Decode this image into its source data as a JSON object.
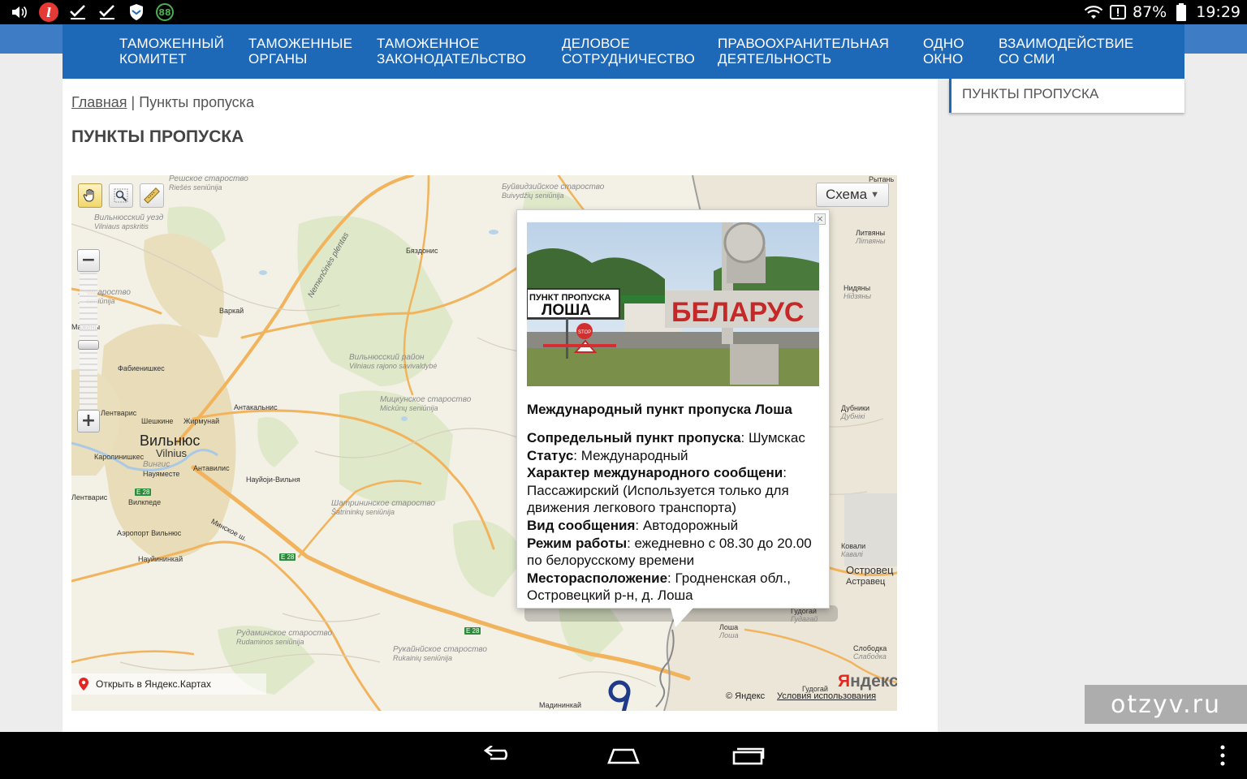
{
  "statusbar": {
    "battery_percent": "87%",
    "time": "19:29",
    "badge_88": "88",
    "app_l": "l"
  },
  "nav": {
    "items": [
      {
        "line1": "Таможенный",
        "line2": "комитет"
      },
      {
        "line1": "Таможенные",
        "line2": "органы"
      },
      {
        "line1": "Таможенное",
        "line2": "законодательство"
      },
      {
        "line1": "Деловое",
        "line2": "сотрудничество"
      },
      {
        "line1": "Правоохранительная",
        "line2": "деятельность"
      },
      {
        "line1": "Одно",
        "line2": "окно"
      },
      {
        "line1": "Взаимодействие",
        "line2": "со СМИ"
      }
    ]
  },
  "sidebar": {
    "item": "ПУНКТЫ ПРОПУСКА"
  },
  "breadcrumb": {
    "home": "Главная",
    "separator": "|",
    "current": "Пункты пропуска"
  },
  "page_title": "ПУНКТЫ ПРОПУСКА",
  "map": {
    "scheme_label": "Схема",
    "open_yandex": "Открыть в Яндекс.Картах",
    "logo_y": "Я",
    "logo_rest": "ндекс",
    "copyright": "© Яндекс",
    "terms": "Условия использования",
    "labels": {
      "vilnius_county": "Вильнюсский уезд",
      "vilnius_county_lt": "Vilniaus apskritis",
      "vilnius": "Вильнюс",
      "vilnius_lt": "Vilnius",
      "vilnius_district": "Вильнюсский район",
      "vilnius_district_lt": "Vilniaus rajono savivaldybė",
      "mickun": "Мицкунское староство",
      "mickun_lt": "Mickūnų seniūnija",
      "buivid": "Буйвидзийское староство",
      "buivid_lt": "Buivydžių seniūnija",
      "riese": "Решское староство",
      "riese_lt": "Riešės seniūnija",
      "sventa": "... староство",
      "sventa_lt": "... seniūnija",
      "shatrinin": "Шатрининское староство",
      "shatrinin_lt": "Šatrininkų seniūnija",
      "rudamin": "Рудаминское староство",
      "rudamin_lt": "Rudaminos seniūnija",
      "rukain": "Рукайнйское староство",
      "rukain_lt": "Rukainių seniūnija",
      "byadonis": "Бяздонис",
      "varkai": "Варкай",
      "fabiyan": "Фабиенишкес",
      "antakal": "Антакальнис",
      "sheshkin": "Шешкине",
      "zhirmunai": "Жирмунай",
      "karolin": "Каролинишкес",
      "vingis": "Вингис",
      "naujamest": "Науяместе",
      "naujoji": "Науйоји-Вильня",
      "antavil": "Антавилис",
      "vilkpede": "Вилкпеде",
      "airport": "Аэропорт Вильнюс",
      "naujin": "Науйининкай",
      "minsk": "Минское ш.",
      "nemencin": "Nemenčinės plentas",
      "mazhen": "Мажены",
      "lentv": "Лентварис",
      "rytan": "Рытань",
      "litviany": "Литвяны",
      "litviany_by": "Літвяны",
      "nidyany": "Нидяны",
      "nidyany_by": "Нідзяны",
      "dubniki": "Дубники",
      "dubniki_by": "Дубнікі",
      "kovali": "Ковали",
      "kovali_by": "Кавалі",
      "ostrovets": "Островец",
      "ostrovets_by": "Астравец",
      "gudogai": "Гудогай",
      "gudogai_by": "Гудагай",
      "losha": "Лоша",
      "losha_by": "Лоша",
      "slobodka": "Слободка",
      "slobodka_by": "Слабодка",
      "gudogai2": "Гудогай",
      "madinin": "Мадининкай",
      "e28a": "E 28",
      "e28b": "E 28",
      "e28c": "E 28"
    },
    "balloon": {
      "photo": {
        "sign_top": "ПУНКТ ПРОПУСКА",
        "sign_name": "ЛОША",
        "country": "БЕЛАРУС",
        "stop": "STOP"
      },
      "title": "Международный пункт пропуска Лоша",
      "fields": [
        {
          "label": "Сопредельный пункт пропуска",
          "value": ": Шумскас"
        },
        {
          "label": "Статус",
          "value": ": Международный"
        },
        {
          "label": "Характер международного сообщени",
          "value": ": Пассажирский (Используется только для движения легкового транспорта)"
        },
        {
          "label": "Вид сообщения",
          "value": ": Автодорожный"
        },
        {
          "label": "Режим работы",
          "value": ": ежедневно с 08.30 до 20.00 по белорусскому времени"
        },
        {
          "label": "Месторасположение",
          "value": ": Гродненская обл., Островецкий р-н, д. Лоша"
        }
      ]
    }
  },
  "watermark": "otzyv.ru",
  "colors": {
    "nav_bg": "#1e68b8",
    "band_bg": "#3e7cc6",
    "yandex_red": "#e52620"
  }
}
